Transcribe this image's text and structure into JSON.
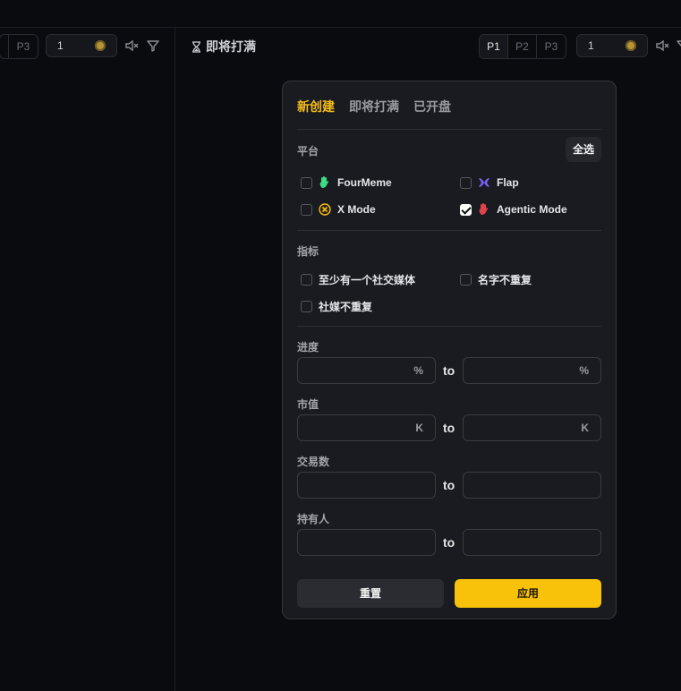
{
  "left_column": {
    "page_buttons": [
      "P3"
    ],
    "amount_value": "1"
  },
  "right_column": {
    "title": "即将打满",
    "page_buttons": [
      "P1",
      "P2",
      "P3"
    ],
    "amount_value": "1"
  },
  "filter_panel": {
    "tabs": [
      {
        "label": "新创建",
        "active": true
      },
      {
        "label": "即将打满",
        "active": false
      },
      {
        "label": "已开盘",
        "active": false
      }
    ],
    "platform": {
      "label": "平台",
      "select_all_label": "全选",
      "options": [
        {
          "label": "FourMeme",
          "checked": false,
          "icon": "fourmeme-icon",
          "color": "#3ddc84"
        },
        {
          "label": "Flap",
          "checked": false,
          "icon": "flap-icon",
          "color": "#7b61ff"
        },
        {
          "label": "X Mode",
          "checked": false,
          "icon": "xmode-icon",
          "color": "#f4bd1a"
        },
        {
          "label": "Agentic Mode",
          "checked": true,
          "icon": "agentic-icon",
          "color": "#e0444a"
        }
      ]
    },
    "indicators": {
      "label": "指标",
      "options": [
        {
          "label": "至少有一个社交媒体",
          "checked": false
        },
        {
          "label": "名字不重复",
          "checked": false
        },
        {
          "label": "社媒不重复",
          "checked": false
        }
      ]
    },
    "ranges": [
      {
        "label": "进度",
        "unit": "%",
        "to_label": "to",
        "min_value": "",
        "max_value": ""
      },
      {
        "label": "市值",
        "unit": "K",
        "to_label": "to",
        "min_value": "",
        "max_value": ""
      },
      {
        "label": "交易数",
        "unit": "",
        "to_label": "to",
        "min_value": "",
        "max_value": ""
      },
      {
        "label": "持有人",
        "unit": "",
        "to_label": "to",
        "min_value": "",
        "max_value": ""
      }
    ],
    "reset_label": "重置",
    "apply_label": "应用"
  },
  "colors": {
    "accent": "#f8c20a",
    "active_tab": "#f4bd1a",
    "background": "#0a0b0f",
    "panel": "#1a1b20"
  }
}
